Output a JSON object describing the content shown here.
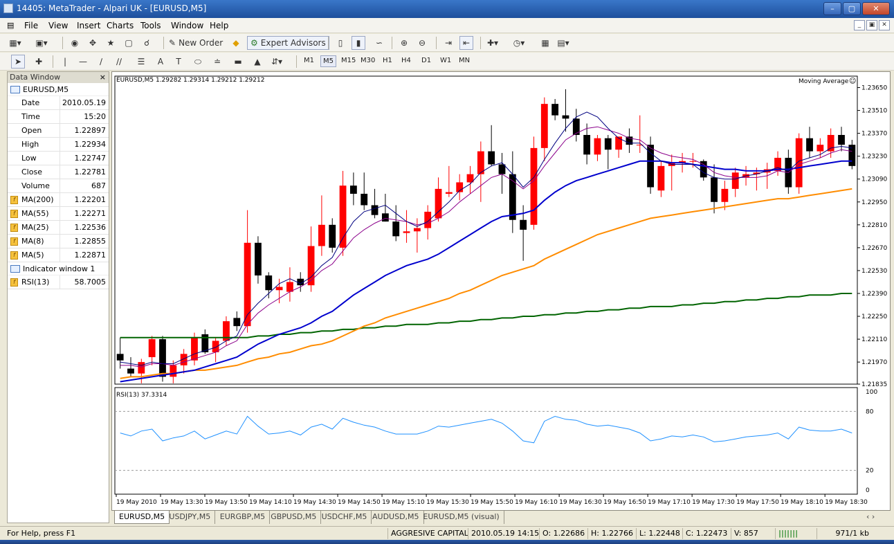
{
  "window": {
    "title": "14405: MetaTrader - Alpari UK - [EURUSD,M5]"
  },
  "menu": [
    "File",
    "View",
    "Insert",
    "Charts",
    "Tools",
    "Window",
    "Help"
  ],
  "toolbar": {
    "new_order": "New Order",
    "expert_advisors": "Expert Advisors"
  },
  "timeframes": [
    "M1",
    "M5",
    "M15",
    "M30",
    "H1",
    "H4",
    "D1",
    "W1",
    "MN"
  ],
  "active_timeframe": "M5",
  "data_window": {
    "title": "Data Window",
    "symbol": "EURUSD,M5",
    "rows": [
      {
        "label": "Date",
        "value": "2010.05.19"
      },
      {
        "label": "Time",
        "value": "15:20"
      },
      {
        "label": "Open",
        "value": "1.22897"
      },
      {
        "label": "High",
        "value": "1.22934"
      },
      {
        "label": "Low",
        "value": "1.22747"
      },
      {
        "label": "Close",
        "value": "1.22781"
      },
      {
        "label": "Volume",
        "value": "687"
      }
    ],
    "indicators": [
      {
        "label": "MA(200)",
        "value": "1.22201"
      },
      {
        "label": "MA(55)",
        "value": "1.22271"
      },
      {
        "label": "MA(25)",
        "value": "1.22536"
      },
      {
        "label": "MA(8)",
        "value": "1.22855"
      },
      {
        "label": "MA(5)",
        "value": "1.22871"
      }
    ],
    "subwindow": "Indicator window 1",
    "rsi": {
      "label": "RSI(13)",
      "value": "58.7005"
    }
  },
  "chart": {
    "header": "EURUSD,M5  1.29282 1.29314 1.29212 1.29212",
    "indicator_label": "Moving Average",
    "rsi_header": "RSI(13) 37.3314",
    "price_ticks": [
      "1.23650",
      "1.23510",
      "1.23370",
      "1.23230",
      "1.23090",
      "1.22950",
      "1.22810",
      "1.22670",
      "1.22530",
      "1.22390",
      "1.22250",
      "1.22110",
      "1.21970",
      "1.21835"
    ],
    "rsi_ticks": [
      "100",
      "80",
      "20",
      "0"
    ],
    "time_labels": [
      "19 May 2010",
      "19 May 13:30",
      "19 May 13:50",
      "19 May 14:10",
      "19 May 14:30",
      "19 May 14:50",
      "19 May 15:10",
      "19 May 15:30",
      "19 May 15:50",
      "19 May 16:10",
      "19 May 16:30",
      "19 May 16:50",
      "19 May 17:10",
      "19 May 17:30",
      "19 May 17:50",
      "19 May 18:10",
      "19 May 18:30"
    ],
    "colors": {
      "bull": "#ff0000",
      "bear": "#000000",
      "ma200": "#006400",
      "ma55": "#ff8c00",
      "ma25": "#0000cd",
      "ma8": "#8b008b",
      "ma5": "#000080",
      "rsi": "#1e90ff"
    }
  },
  "chart_data": {
    "type": "candlestick",
    "ylim": [
      1.21835,
      1.2372
    ],
    "rsi_ylim": [
      0,
      100
    ],
    "candles": [
      [
        1.2202,
        1.2212,
        1.2193,
        1.2198
      ],
      [
        1.2193,
        1.22,
        1.2188,
        1.219
      ],
      [
        1.219,
        1.2199,
        1.2184,
        1.2197
      ],
      [
        1.22,
        1.2213,
        1.2195,
        1.2211
      ],
      [
        1.2211,
        1.2213,
        1.2185,
        1.2188
      ],
      [
        1.2188,
        1.2198,
        1.2184,
        1.2195
      ],
      [
        1.2195,
        1.2205,
        1.219,
        1.2202
      ],
      [
        1.2198,
        1.2215,
        1.2195,
        1.2212
      ],
      [
        1.2214,
        1.2217,
        1.2202,
        1.2203
      ],
      [
        1.2203,
        1.2212,
        1.2197,
        1.221
      ],
      [
        1.221,
        1.2225,
        1.2207,
        1.2222
      ],
      [
        1.2224,
        1.2228,
        1.2216,
        1.2219
      ],
      [
        1.2219,
        1.229,
        1.2215,
        1.227
      ],
      [
        1.227,
        1.2274,
        1.2245,
        1.225
      ],
      [
        1.225,
        1.2252,
        1.2236,
        1.2241
      ],
      [
        1.2241,
        1.2248,
        1.2233,
        1.2243
      ],
      [
        1.224,
        1.2255,
        1.2234,
        1.2246
      ],
      [
        1.2248,
        1.2252,
        1.224,
        1.2244
      ],
      [
        1.2244,
        1.228,
        1.224,
        1.2268
      ],
      [
        1.2268,
        1.2299,
        1.2262,
        1.2281
      ],
      [
        1.2281,
        1.2285,
        1.2264,
        1.2267
      ],
      [
        1.2267,
        1.2314,
        1.2262,
        1.2305
      ],
      [
        1.2305,
        1.2313,
        1.2293,
        1.23
      ],
      [
        1.23,
        1.2313,
        1.229,
        1.2293
      ],
      [
        1.2293,
        1.2303,
        1.2285,
        1.2287
      ],
      [
        1.2288,
        1.23,
        1.2283,
        1.2283
      ],
      [
        1.2283,
        1.2293,
        1.2271,
        1.2274
      ],
      [
        1.2276,
        1.229,
        1.227,
        1.2277
      ],
      [
        1.2277,
        1.2285,
        1.2264,
        1.2279
      ],
      [
        1.2279,
        1.2293,
        1.2272,
        1.2289
      ],
      [
        1.2285,
        1.231,
        1.2283,
        1.2303
      ],
      [
        1.23,
        1.2317,
        1.2298,
        1.2301
      ],
      [
        1.2301,
        1.2312,
        1.2296,
        1.2307
      ],
      [
        1.2307,
        1.2317,
        1.23,
        1.2312
      ],
      [
        1.2312,
        1.2332,
        1.2295,
        1.2326
      ],
      [
        1.2326,
        1.2342,
        1.2317,
        1.2318
      ],
      [
        1.2318,
        1.2325,
        1.23,
        1.2312
      ],
      [
        1.2312,
        1.2326,
        1.2276,
        1.2284
      ],
      [
        1.2284,
        1.2293,
        1.2259,
        1.2278
      ],
      [
        1.2281,
        1.2335,
        1.2278,
        1.2328
      ],
      [
        1.2328,
        1.2359,
        1.232,
        1.2355
      ],
      [
        1.2355,
        1.2358,
        1.2345,
        1.2348
      ],
      [
        1.2348,
        1.2364,
        1.2338,
        1.2346
      ],
      [
        1.2346,
        1.2352,
        1.2332,
        1.2336
      ],
      [
        1.2336,
        1.2343,
        1.2318,
        1.2324
      ],
      [
        1.2324,
        1.2336,
        1.232,
        1.2334
      ],
      [
        1.2334,
        1.2336,
        1.2315,
        1.2327
      ],
      [
        1.2327,
        1.2334,
        1.2322,
        1.2335
      ],
      [
        1.2335,
        1.234,
        1.2325,
        1.233
      ],
      [
        1.233,
        1.2348,
        1.2325,
        1.233
      ],
      [
        1.233,
        1.2335,
        1.23,
        1.2304
      ],
      [
        1.2302,
        1.232,
        1.2298,
        1.2317
      ],
      [
        1.2317,
        1.2324,
        1.2302,
        1.2319
      ],
      [
        1.2319,
        1.2325,
        1.2313,
        1.232
      ],
      [
        1.232,
        1.2325,
        1.2316,
        1.232
      ],
      [
        1.232,
        1.2321,
        1.2308,
        1.231
      ],
      [
        1.231,
        1.2318,
        1.2288,
        1.2295
      ],
      [
        1.2295,
        1.2308,
        1.229,
        1.2303
      ],
      [
        1.2303,
        1.2316,
        1.2298,
        1.2313
      ],
      [
        1.231,
        1.2317,
        1.2305,
        1.2312
      ],
      [
        1.2312,
        1.2316,
        1.2302,
        1.2313
      ],
      [
        1.2313,
        1.2319,
        1.2303,
        1.2315
      ],
      [
        1.2314,
        1.2326,
        1.2311,
        1.2322
      ],
      [
        1.2322,
        1.2327,
        1.23,
        1.2304
      ],
      [
        1.2304,
        1.2337,
        1.23,
        1.2334
      ],
      [
        1.2334,
        1.2341,
        1.2322,
        1.2326
      ],
      [
        1.2326,
        1.2334,
        1.2322,
        1.233
      ],
      [
        1.2326,
        1.234,
        1.2322,
        1.2336
      ],
      [
        1.2336,
        1.2341,
        1.2326,
        1.233
      ],
      [
        1.233,
        1.2333,
        1.2315,
        1.2317
      ]
    ],
    "series": [
      {
        "name": "MA(200)",
        "values": [
          1.2212,
          1.2212,
          1.2212,
          1.2212,
          1.2212,
          1.2212,
          1.2212,
          1.2212,
          1.2212,
          1.2212,
          1.2212,
          1.2212,
          1.2212,
          1.2213,
          1.2213,
          1.2214,
          1.2214,
          1.2215,
          1.2215,
          1.2216,
          1.2216,
          1.2217,
          1.2217,
          1.2218,
          1.2218,
          1.2219,
          1.2219,
          1.222,
          1.222,
          1.222,
          1.2221,
          1.2221,
          1.2222,
          1.2222,
          1.2223,
          1.2223,
          1.2224,
          1.2224,
          1.2225,
          1.2225,
          1.2226,
          1.2226,
          1.2227,
          1.2227,
          1.2228,
          1.2228,
          1.2229,
          1.2229,
          1.223,
          1.223,
          1.2231,
          1.2231,
          1.2231,
          1.2232,
          1.2232,
          1.2233,
          1.2233,
          1.2234,
          1.2234,
          1.2235,
          1.2235,
          1.2236,
          1.2236,
          1.2237,
          1.2237,
          1.2238,
          1.2238,
          1.2238,
          1.2239,
          1.2239
        ]
      },
      {
        "name": "MA(55)",
        "values": [
          1.2187,
          1.2188,
          1.2188,
          1.2189,
          1.219,
          1.219,
          1.2191,
          1.2192,
          1.2192,
          1.2193,
          1.2194,
          1.2195,
          1.2197,
          1.2199,
          1.22,
          1.2202,
          1.2203,
          1.2205,
          1.2207,
          1.2208,
          1.221,
          1.2213,
          1.2216,
          1.2219,
          1.2221,
          1.2224,
          1.2226,
          1.2228,
          1.223,
          1.2232,
          1.2234,
          1.2236,
          1.2239,
          1.2241,
          1.2244,
          1.2247,
          1.225,
          1.2252,
          1.2254,
          1.2256,
          1.226,
          1.2263,
          1.2266,
          1.2269,
          1.2272,
          1.2275,
          1.2277,
          1.2279,
          1.2281,
          1.2283,
          1.2285,
          1.2286,
          1.2287,
          1.2288,
          1.2289,
          1.229,
          1.2291,
          1.2292,
          1.2293,
          1.2294,
          1.2295,
          1.2296,
          1.2297,
          1.2297,
          1.2298,
          1.2299,
          1.23,
          1.2301,
          1.2302,
          1.2303
        ]
      },
      {
        "name": "MA(25)",
        "values": [
          1.2185,
          1.2186,
          1.2187,
          1.2188,
          1.2189,
          1.219,
          1.2191,
          1.2192,
          1.2194,
          1.2196,
          1.2198,
          1.22,
          1.2204,
          1.2208,
          1.2211,
          1.2214,
          1.2216,
          1.2218,
          1.2221,
          1.2225,
          1.2228,
          1.2233,
          1.2238,
          1.2242,
          1.2246,
          1.225,
          1.2253,
          1.2256,
          1.2258,
          1.226,
          1.2263,
          1.2267,
          1.2271,
          1.2275,
          1.2279,
          1.2283,
          1.2286,
          1.2287,
          1.2288,
          1.229,
          1.2296,
          1.2301,
          1.2305,
          1.2308,
          1.231,
          1.2312,
          1.2314,
          1.2316,
          1.2318,
          1.232,
          1.232,
          1.232,
          1.2319,
          1.2319,
          1.2318,
          1.2317,
          1.2316,
          1.2315,
          1.2315,
          1.2314,
          1.2314,
          1.2314,
          1.2315,
          1.2315,
          1.2316,
          1.2317,
          1.2318,
          1.2319,
          1.232,
          1.232
        ]
      },
      {
        "name": "MA(8)",
        "values": [
          1.2195,
          1.2195,
          1.2194,
          1.2196,
          1.2196,
          1.2195,
          1.2197,
          1.2199,
          1.2201,
          1.2203,
          1.2207,
          1.221,
          1.222,
          1.2227,
          1.2232,
          1.2236,
          1.224,
          1.2243,
          1.2247,
          1.2253,
          1.2257,
          1.2265,
          1.2273,
          1.2278,
          1.2282,
          1.2285,
          1.2284,
          1.2283,
          1.2281,
          1.2282,
          1.2285,
          1.2289,
          1.2295,
          1.23,
          1.2305,
          1.231,
          1.2312,
          1.2308,
          1.2303,
          1.2308,
          1.2317,
          1.2325,
          1.2333,
          1.2337,
          1.234,
          1.2341,
          1.2339,
          1.2337,
          1.2334,
          1.2333,
          1.2328,
          1.2325,
          1.2323,
          1.2322,
          1.2321,
          1.2318,
          1.2313,
          1.2311,
          1.231,
          1.231,
          1.231,
          1.2311,
          1.2314,
          1.2313,
          1.2318,
          1.232,
          1.2322,
          1.2325,
          1.2327,
          1.2326
        ]
      },
      {
        "name": "MA(5)",
        "values": [
          1.2197,
          1.2196,
          1.2195,
          1.2197,
          1.2196,
          1.2196,
          1.2199,
          1.2202,
          1.2204,
          1.2206,
          1.221,
          1.2213,
          1.2226,
          1.2233,
          1.2239,
          1.2245,
          1.2248,
          1.2245,
          1.2249,
          1.2256,
          1.2261,
          1.2273,
          1.2283,
          1.2289,
          1.2291,
          1.2293,
          1.2288,
          1.2283,
          1.228,
          1.2283,
          1.2289,
          1.2295,
          1.2302,
          1.2306,
          1.2313,
          1.2317,
          1.2319,
          1.2312,
          1.2304,
          1.231,
          1.2321,
          1.2331,
          1.234,
          1.2347,
          1.235,
          1.2347,
          1.234,
          1.2334,
          1.2331,
          1.2331,
          1.2325,
          1.232,
          1.2318,
          1.2318,
          1.2318,
          1.2313,
          1.231,
          1.2309,
          1.2309,
          1.2311,
          1.2312,
          1.2314,
          1.2316,
          1.2314,
          1.232,
          1.2322,
          1.2324,
          1.2328,
          1.2329,
          1.2328
        ]
      },
      {
        "name": "RSI(13)",
        "values": [
          58,
          55,
          60,
          62,
          50,
          53,
          55,
          60,
          52,
          56,
          60,
          57,
          75,
          65,
          57,
          58,
          60,
          56,
          64,
          67,
          62,
          73,
          69,
          66,
          64,
          60,
          57,
          57,
          57,
          60,
          65,
          64,
          66,
          68,
          70,
          72,
          68,
          60,
          50,
          48,
          70,
          75,
          72,
          71,
          67,
          65,
          66,
          64,
          62,
          58,
          50,
          52,
          55,
          54,
          56,
          54,
          49,
          50,
          52,
          54,
          55,
          56,
          58,
          52,
          64,
          61,
          60,
          60,
          62,
          58
        ]
      }
    ]
  },
  "tabs": [
    "EURUSD,M5",
    "USDJPY,M5",
    "EURGBP,M5",
    "GBPUSD,M5",
    "USDCHF,M5",
    "AUDUSD,M5",
    "EURUSD,M5 (visual)"
  ],
  "status": {
    "help": "For Help, press F1",
    "profile": "AGGRESIVE CAPITAL T",
    "datetime": "2010.05.19 14:15",
    "open": "O: 1.22686",
    "high": "H: 1.22766",
    "low": "L: 1.22448",
    "close": "C: 1.22473",
    "volume": "V: 857",
    "traffic": "971/1 kb"
  }
}
